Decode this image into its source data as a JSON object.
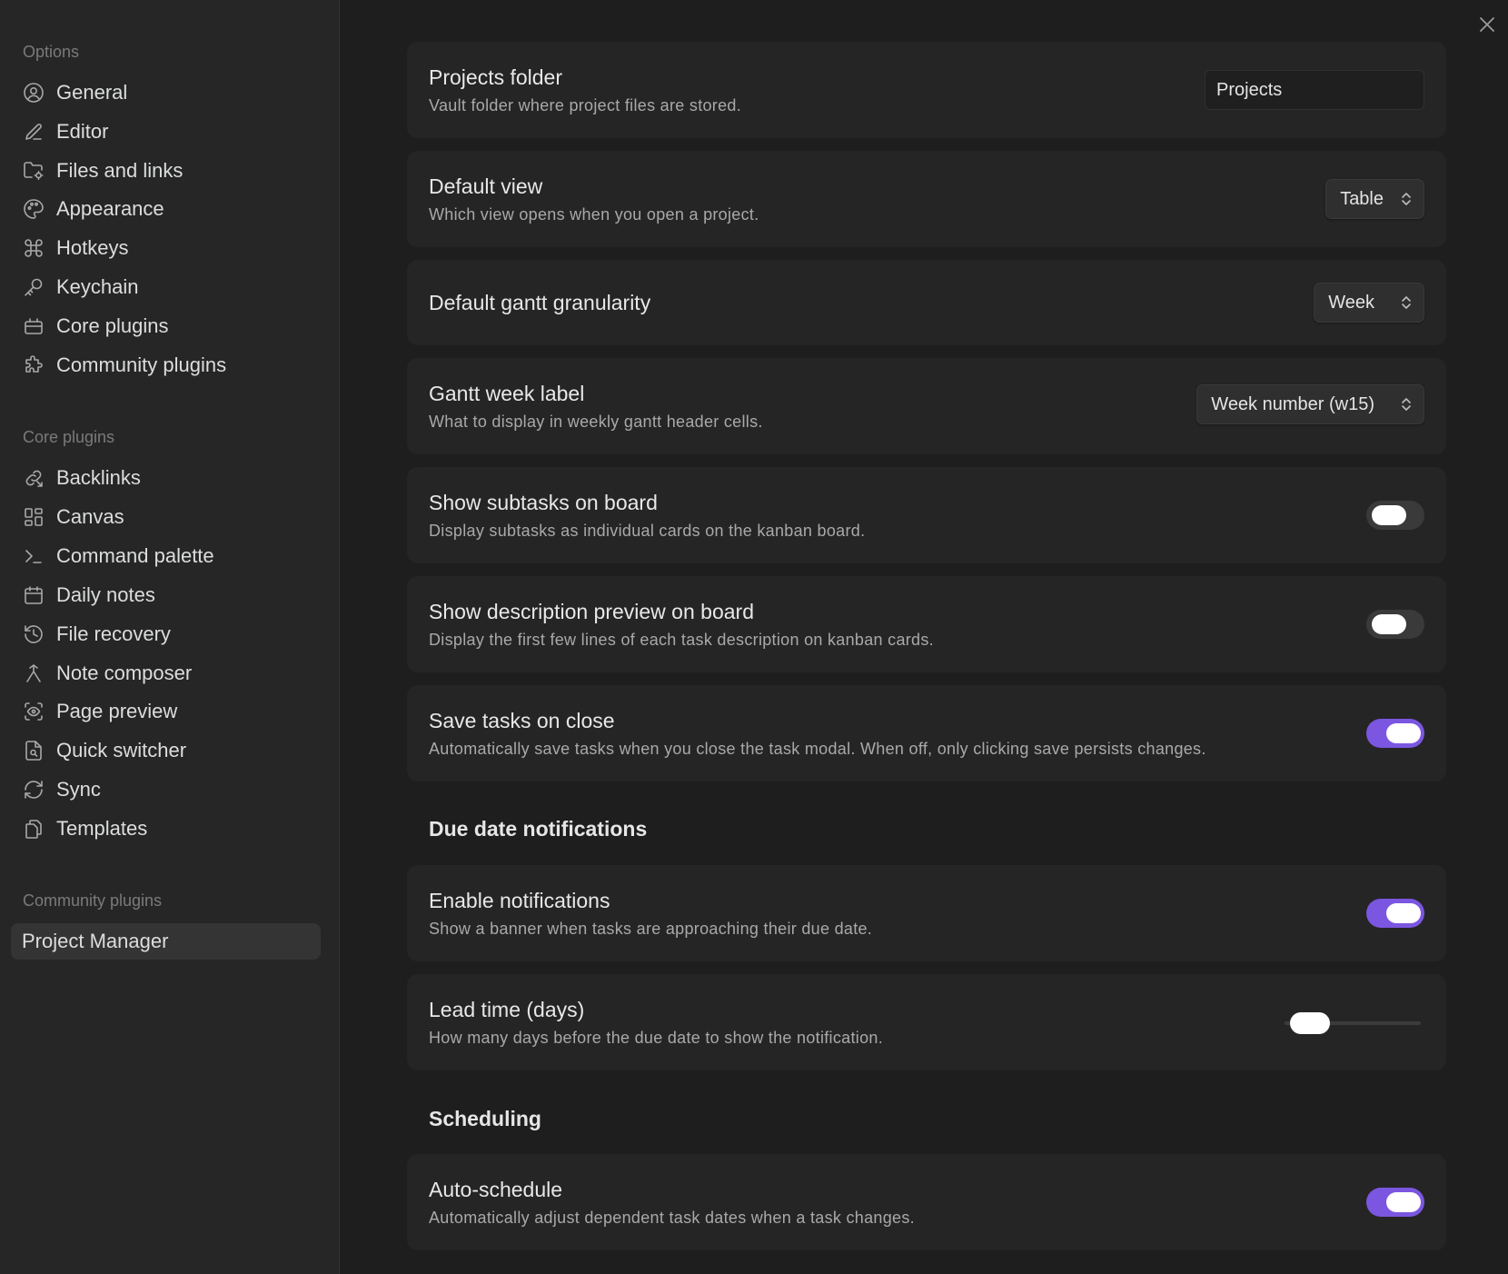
{
  "sidebar": {
    "options_header": "Options",
    "options": [
      {
        "label": "General",
        "icon": "user-circle-icon"
      },
      {
        "label": "Editor",
        "icon": "pencil-icon"
      },
      {
        "label": "Files and links",
        "icon": "folder-gear-icon"
      },
      {
        "label": "Appearance",
        "icon": "palette-icon"
      },
      {
        "label": "Hotkeys",
        "icon": "command-icon"
      },
      {
        "label": "Keychain",
        "icon": "key-icon"
      },
      {
        "label": "Core plugins",
        "icon": "plug-icon"
      },
      {
        "label": "Community plugins",
        "icon": "puzzle-icon"
      }
    ],
    "core_header": "Core plugins",
    "core": [
      {
        "label": "Backlinks",
        "icon": "backlinks-icon"
      },
      {
        "label": "Canvas",
        "icon": "layout-dashboard-icon"
      },
      {
        "label": "Command palette",
        "icon": "terminal-icon"
      },
      {
        "label": "Daily notes",
        "icon": "calendar-icon"
      },
      {
        "label": "File recovery",
        "icon": "history-icon"
      },
      {
        "label": "Note composer",
        "icon": "merge-icon"
      },
      {
        "label": "Page preview",
        "icon": "scan-eye-icon"
      },
      {
        "label": "Quick switcher",
        "icon": "file-search-icon"
      },
      {
        "label": "Sync",
        "icon": "refresh-icon"
      },
      {
        "label": "Templates",
        "icon": "files-icon"
      }
    ],
    "community_header": "Community plugins",
    "community": [
      {
        "label": "Project Manager"
      }
    ]
  },
  "settings": {
    "projects_folder": {
      "title": "Projects folder",
      "desc": "Vault folder where project files are stored.",
      "value": "Projects"
    },
    "default_view": {
      "title": "Default view",
      "desc": "Which view opens when you open a project.",
      "value": "Table"
    },
    "gantt_granularity": {
      "title": "Default gantt granularity",
      "value": "Week"
    },
    "gantt_week_label": {
      "title": "Gantt week label",
      "desc": "What to display in weekly gantt header cells.",
      "value": "Week number (w15)"
    },
    "show_subtasks": {
      "title": "Show subtasks on board",
      "desc": "Display subtasks as individual cards on the kanban board.",
      "enabled": false
    },
    "show_description": {
      "title": "Show description preview on board",
      "desc": "Display the first few lines of each task description on kanban cards.",
      "enabled": false
    },
    "save_on_close": {
      "title": "Save tasks on close",
      "desc": "Automatically save tasks when you close the task modal. When off, only clicking save persists changes.",
      "enabled": true
    },
    "due_heading": "Due date notifications",
    "enable_notifications": {
      "title": "Enable notifications",
      "desc": "Show a banner when tasks are approaching their due date.",
      "enabled": true
    },
    "lead_time": {
      "title": "Lead time (days)",
      "desc": "How many days before the due date to show the notification.",
      "level": 0.1
    },
    "scheduling_heading": "Scheduling",
    "auto_schedule": {
      "title": "Auto-schedule",
      "desc": "Automatically adjust dependent task dates when a task changes.",
      "enabled": true
    }
  },
  "colors": {
    "accent": "#7b56e0",
    "background": "#1e1e1e",
    "sidebar": "#262626",
    "card": "#252525"
  }
}
